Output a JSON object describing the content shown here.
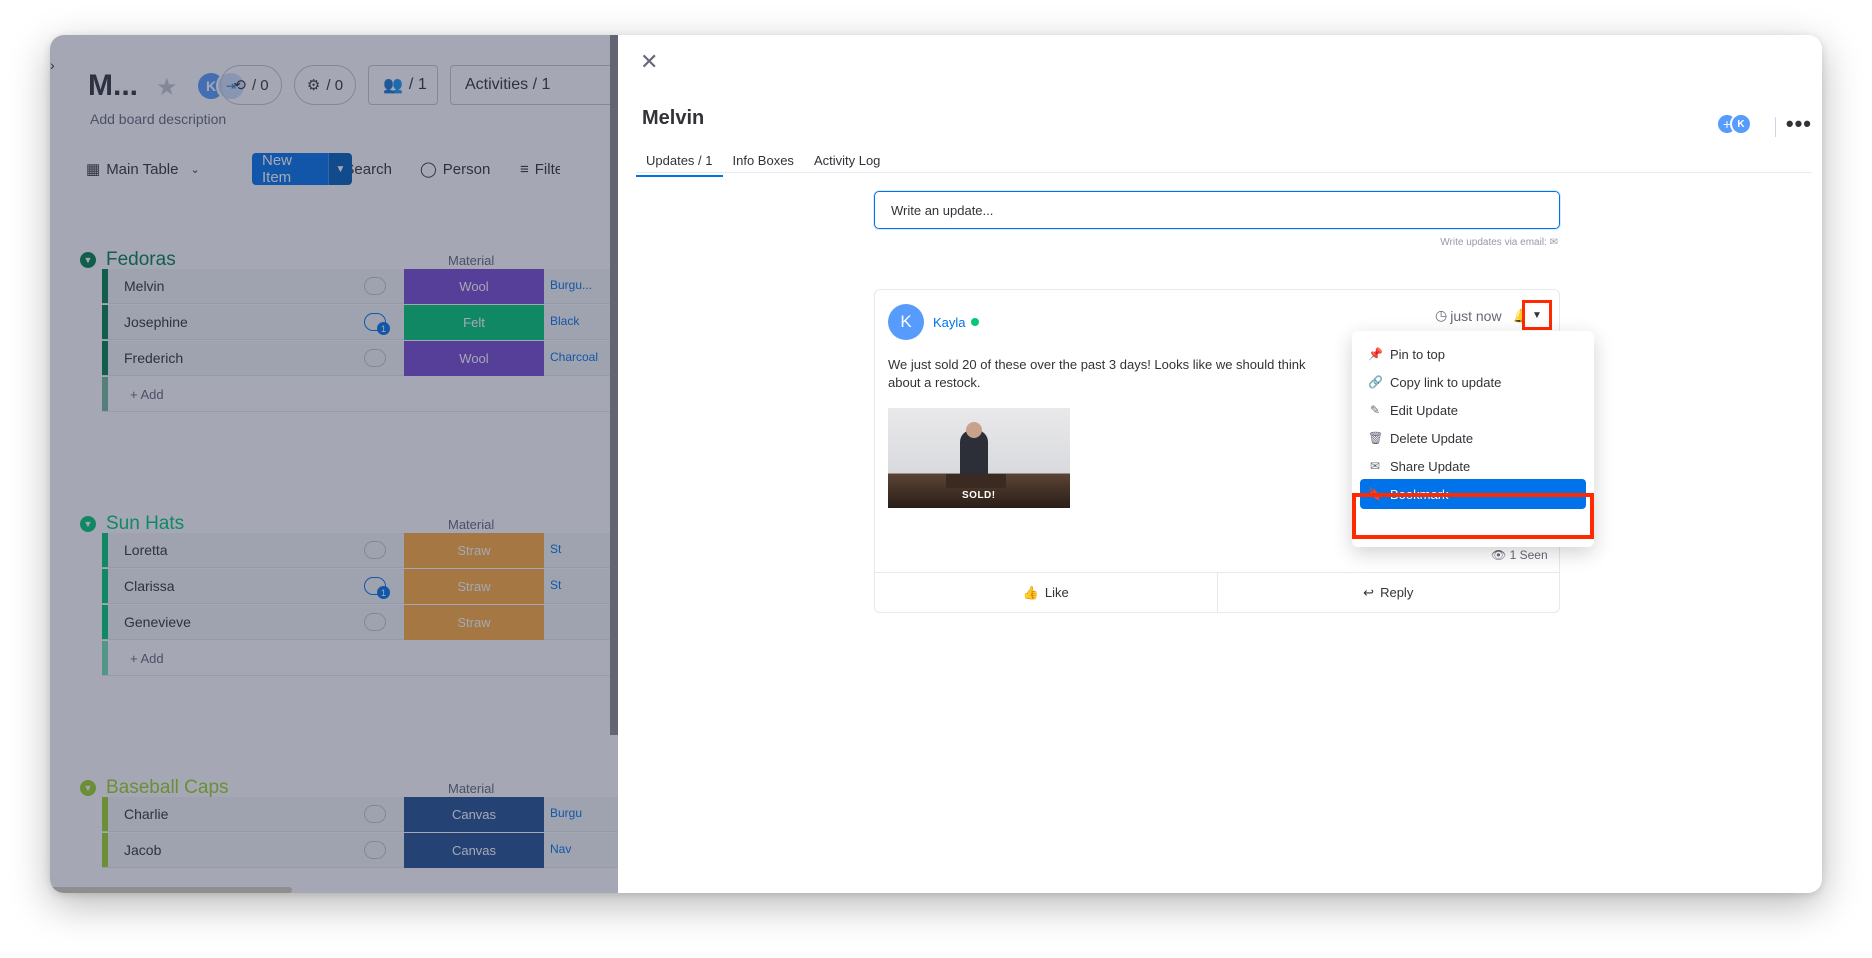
{
  "board": {
    "title": "M...",
    "description": "Add board description",
    "avatar_initial": "K",
    "automations_count": "/ 0",
    "integrations_count": "/ 0",
    "members_count": "/ 1",
    "activities_label": "Activities / 1",
    "toolbar": {
      "main_table": "Main Table",
      "new_item": "New Item",
      "search": "Search",
      "person": "Person",
      "filter": "Filter"
    },
    "groups": [
      {
        "name": "Fedoras",
        "color": "#037f4c",
        "column_header": "Material",
        "rows": [
          {
            "name": "Melvin",
            "status": "Wool",
            "status_color": "#784bd1",
            "color_value": "Burgu...",
            "has_update": false
          },
          {
            "name": "Josephine",
            "status": "Felt",
            "status_color": "#00c875",
            "color_value": "Black",
            "has_update": true,
            "update_count": "1"
          },
          {
            "name": "Frederich",
            "status": "Wool",
            "status_color": "#784bd1",
            "color_value": "Charcoal",
            "has_update": false
          }
        ],
        "add_label": "+ Add"
      },
      {
        "name": "Sun Hats",
        "color": "#00c875",
        "column_header": "Material",
        "rows": [
          {
            "name": "Loretta",
            "status": "Straw",
            "status_color": "#fdab3d",
            "color_value": "St",
            "has_update": false
          },
          {
            "name": "Clarissa",
            "status": "Straw",
            "status_color": "#fdab3d",
            "color_value": "St",
            "has_update": true,
            "update_count": "1"
          },
          {
            "name": "Genevieve",
            "status": "Straw",
            "status_color": "#fdab3d",
            "color_value": "",
            "has_update": false
          }
        ],
        "add_label": "+ Add"
      },
      {
        "name": "Baseball Caps",
        "color": "#9cd326",
        "column_header": "Material",
        "rows": [
          {
            "name": "Charlie",
            "status": "Canvas",
            "status_color": "#225091",
            "color_value": "Burgu",
            "has_update": false
          },
          {
            "name": "Jacob",
            "status": "Canvas",
            "status_color": "#225091",
            "color_value": "Nav",
            "has_update": false
          }
        ]
      }
    ]
  },
  "panel": {
    "item_title": "Melvin",
    "avatar_initial": "K",
    "tabs": [
      {
        "label": "Updates / 1",
        "active": true
      },
      {
        "label": "Info Boxes",
        "active": false
      },
      {
        "label": "Activity Log",
        "active": false
      }
    ],
    "write_placeholder": "Write an update...",
    "email_hint": "Write updates via email:",
    "post": {
      "author_initial": "K",
      "author": "Kayla",
      "time": "just now",
      "body": "We just sold 20 of these over the past 3 days! Looks like we should think about a restock.",
      "gif_caption": "SOLD!",
      "seen": "1 Seen",
      "like": "Like",
      "reply": "Reply"
    },
    "menu": [
      {
        "label": "Pin to top",
        "icon": "pin-icon",
        "selected": false
      },
      {
        "label": "Copy link to update",
        "icon": "link-icon",
        "selected": false
      },
      {
        "label": "Edit Update",
        "icon": "pencil-icon",
        "selected": false
      },
      {
        "label": "Delete Update",
        "icon": "trash-icon",
        "selected": false
      },
      {
        "label": "Share Update",
        "icon": "envelope-icon",
        "selected": false
      },
      {
        "label": "Bookmark",
        "icon": "bookmark-icon",
        "selected": true
      }
    ]
  },
  "colors": {
    "accent": "#0073ea",
    "highlight": "#ff2a00"
  }
}
